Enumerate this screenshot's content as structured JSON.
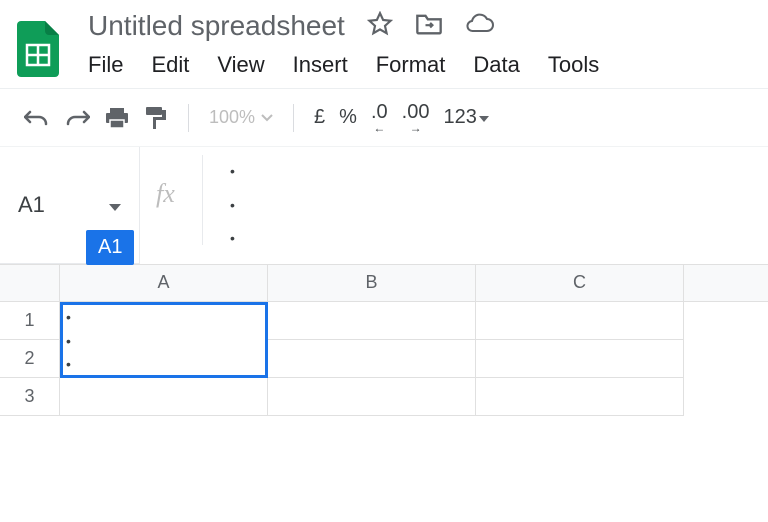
{
  "header": {
    "title": "Untitled spreadsheet"
  },
  "menubar": {
    "items": [
      "File",
      "Edit",
      "View",
      "Insert",
      "Format",
      "Data",
      "Tools"
    ]
  },
  "toolbar": {
    "zoom": "100%",
    "currency": "£",
    "percent": "%",
    "dec_less": ".0",
    "dec_more": ".00",
    "more_formats": "123"
  },
  "namebox": {
    "value": "A1"
  },
  "formula": {
    "lines": [
      "",
      "",
      ""
    ]
  },
  "sheet": {
    "active_badge": "A1",
    "columns": [
      "A",
      "B",
      "C"
    ],
    "rows": [
      "1",
      "2",
      "3"
    ],
    "active_cell_lines": [
      "",
      "",
      ""
    ]
  }
}
